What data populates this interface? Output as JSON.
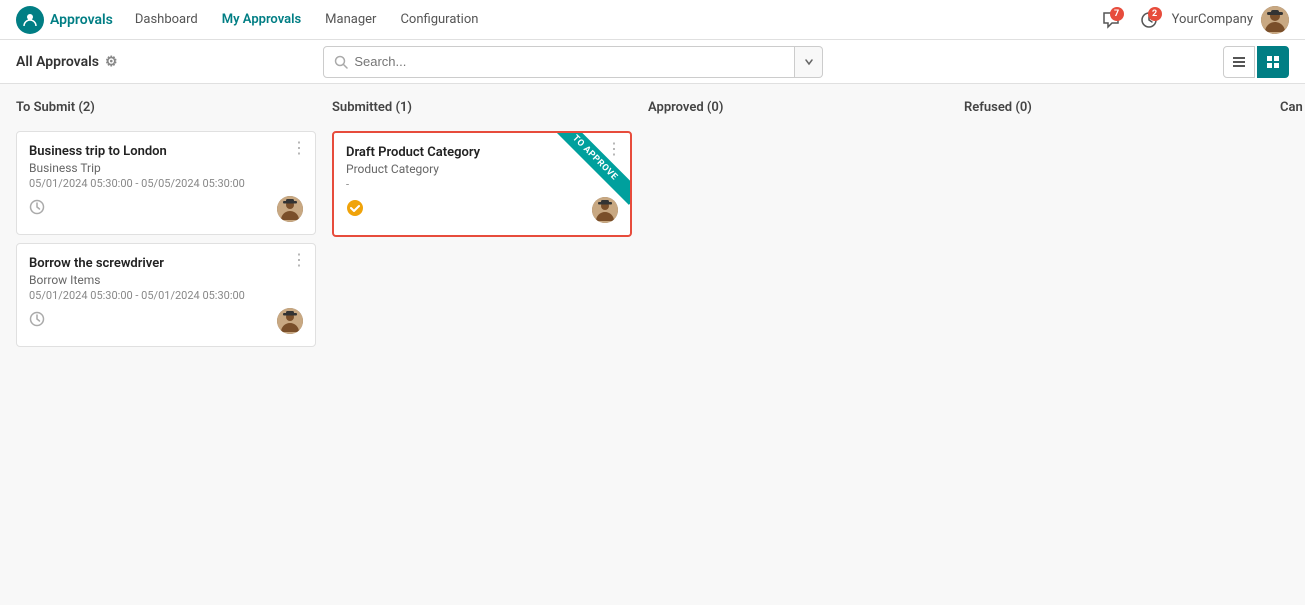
{
  "topnav": {
    "brand": "Approvals",
    "links": [
      {
        "label": "Dashboard",
        "active": false
      },
      {
        "label": "My Approvals",
        "active": true
      },
      {
        "label": "Manager",
        "active": false
      },
      {
        "label": "Configuration",
        "active": false
      }
    ],
    "notifications": [
      {
        "icon": "💬",
        "count": "7"
      },
      {
        "icon": "🕐",
        "count": "2"
      }
    ],
    "company": "YourCompany"
  },
  "subheader": {
    "title": "All Approvals",
    "gear_label": "⚙",
    "search_placeholder": "Search...",
    "view_list_label": "☰",
    "view_kanban_label": "⊞"
  },
  "kanban": {
    "columns": [
      {
        "id": "to-submit",
        "header": "To Submit (2)",
        "cards": [
          {
            "id": "business-trip",
            "title": "Business trip to London",
            "subtitle": "Business Trip",
            "date": "05/01/2024 05:30:00 - 05/05/2024 05:30:00",
            "has_clock": true,
            "has_check": false,
            "highlighted": false,
            "ribbon": null
          },
          {
            "id": "borrow-screwdriver",
            "title": "Borrow the screwdriver",
            "subtitle": "Borrow Items",
            "date": "05/01/2024 05:30:00 - 05/01/2024 05:30:00",
            "has_clock": true,
            "has_check": false,
            "highlighted": false,
            "ribbon": null
          }
        ]
      },
      {
        "id": "submitted",
        "header": "Submitted (1)",
        "cards": [
          {
            "id": "draft-product",
            "title": "Draft Product Category",
            "subtitle": "Product Category",
            "date": "-",
            "has_clock": false,
            "has_check": true,
            "highlighted": true,
            "ribbon": "TO APPROVE"
          }
        ]
      },
      {
        "id": "approved",
        "header": "Approved (0)",
        "cards": []
      },
      {
        "id": "refused",
        "header": "Refused (0)",
        "cards": []
      },
      {
        "id": "cancelled",
        "header": "Can",
        "cards": []
      }
    ]
  }
}
